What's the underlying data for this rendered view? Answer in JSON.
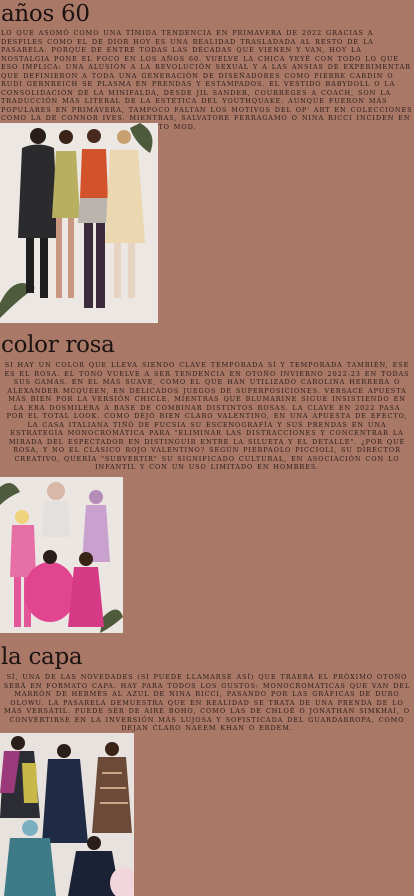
{
  "sections": [
    {
      "title": "años 60",
      "body": "Lo que asomó como una tímida tendencia en primavera de 2022 gracias a desfiles como el de Dior hoy es una realidad trasladada al resto de la pasarela. Porque de entre todas las décadas que vienen y van, hoy la nostalgia pone el foco en los años 60. Vuelve la chica yeyé con todo lo que eso implica: una alusión a la revolución sexual y a las ansias de experimentar que definieron a toda una generación de diseñadores como Pierre Cardin o Rudi Gernreich se plasma en prendas y estampados. El vestido babydoll o la consolidación de la minifalda, desde Jil Sander, Courrèges a Coach, son la traducción más literal de la estética del youthquake. Aunque fueron más populares en primavera, tampoco faltan los motivos del op' art en colecciones como la de Connor Ives. Mientras, Salvatore Ferragamo o Nina Ricci inciden en prendas minimalistas de regusto mod."
    },
    {
      "title": "color rosa",
      "body": "Si hay un color que lleva siendo clave temporada sí y temporada también, ese es el rosa. El tono vuelve a ser tendencia en otoño invierno 2022-23 en todas sus gamas. En el más suave, como el que han utilizado Carolina Herrera o Alexander McQueen, en delicados juegos de superposiciones. Versace apuesta más bien por la versión chicle, mientras que Blumarine sigue insistiendo en la era dosmilera a base de combinar distintos rosas. La clave en 2022 pasa por el total look. Como dejó bien claro Valentino, en una apuesta de efecto, la casa italiana tiñó de fucsia su escenografía y sus prendas en una estrategia monocromática para \"eliminar las distracciones y concentrar la mirada del espectador en distinguir entre la silueta y el detalle\". ¿Por qué rosa, y no el clásico rojo Valentino? Según Pierpaolo Piccioli, su director creativo, quería \"subvertir\" su significado cultural, en asociación con lo infantil y con un uso limitado en hombres."
    },
    {
      "title": "la capa",
      "body": "Sí, una de las novedades (si puede llamarse así) que traerá el próximo otoño será en formato capa. Hay para todos los gustos: monocromáticas que van del marrón de Hermès al azul de Nina Ricci, pasando por las gráficas de Duro Olowu. La pasarela demuestra que en realidad se trata de una prenda de lo más versátil. Puede ser de aire boho, como las de Chloé o Jonathan Simkhai, o convertirse en la inversión más lujosa y sofisticada del guardarropa, como dejan claro Naeem Khan o Erdem."
    }
  ],
  "colors": {
    "background": "#a97867",
    "text": "#1f1513",
    "pink": "#e2458f"
  }
}
